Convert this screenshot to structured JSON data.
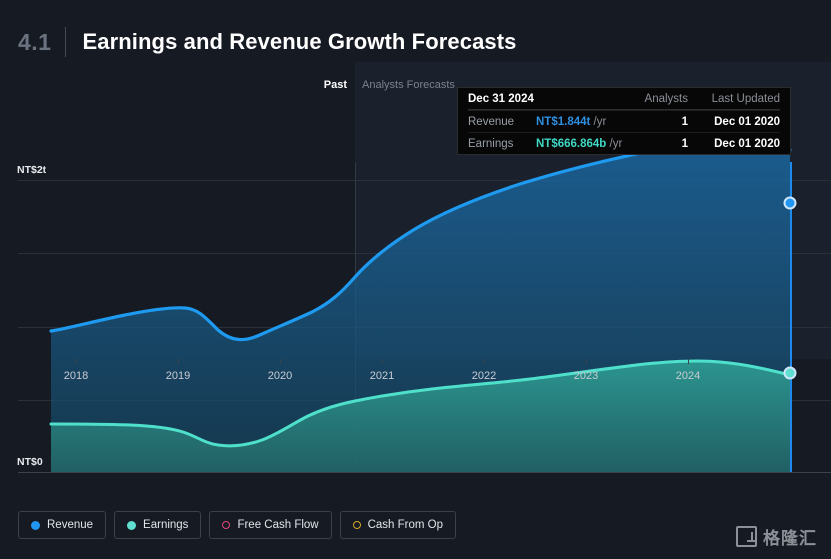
{
  "header": {
    "section_number": "4.1",
    "title": "Earnings and Revenue Growth Forecasts"
  },
  "tooltip": {
    "date": "Dec 31 2024",
    "col_analysts": "Analysts",
    "col_updated": "Last Updated",
    "rows": [
      {
        "name": "Revenue",
        "value": "NT$1.844t",
        "unit": "/yr",
        "analysts": "1",
        "updated": "Dec 01 2020",
        "color": "#2f8fe0"
      },
      {
        "name": "Earnings",
        "value": "NT$666.864b",
        "unit": "/yr",
        "analysts": "1",
        "updated": "Dec 01 2020",
        "color": "#3fd8c4"
      }
    ]
  },
  "chart_labels": {
    "past": "Past",
    "forecast": "Analysts Forecasts",
    "y_top": "NT$2t",
    "y_bottom": "NT$0"
  },
  "legend": [
    {
      "label": "Revenue",
      "color": "#2196f3",
      "filled": true
    },
    {
      "label": "Earnings",
      "color": "#5fded0",
      "filled": true
    },
    {
      "label": "Free Cash Flow",
      "color": "#e0457b",
      "filled": false
    },
    {
      "label": "Cash From Op",
      "color": "#d6a62a",
      "filled": false
    }
  ],
  "watermark": {
    "text": "格隆汇"
  },
  "chart_data": {
    "type": "area",
    "title": "Earnings and Revenue Growth Forecasts",
    "xlabel": "",
    "ylabel": "NT$",
    "ylim": [
      0,
      2.0
    ],
    "y_ticks": [
      0,
      0.5,
      1.0,
      1.5,
      2.0
    ],
    "y_tick_labels": [
      "NT$0",
      "",
      "",
      "",
      "NT$2t"
    ],
    "grid": true,
    "legend_position": "bottom-left",
    "categories": [
      "2018",
      "2019",
      "2020",
      "2021",
      "2022",
      "2023",
      "2024"
    ],
    "x_tick_values": [
      2018,
      2019,
      2020,
      2021,
      2022,
      2023,
      2024
    ],
    "forecast_start": 2020.72,
    "annotations": [
      {
        "text": "Past",
        "x": 2020.6
      },
      {
        "text": "Analysts Forecasts",
        "x": 2020.85
      }
    ],
    "highlight": {
      "x_label": "Dec 31 2024",
      "revenue": 1.844,
      "earnings": 0.666864
    },
    "series": [
      {
        "name": "Revenue",
        "color": "#2196f3",
        "unit": "NT$ trillions",
        "x": [
          2017.75,
          2018.0,
          2018.5,
          2019.0,
          2019.25,
          2019.5,
          2020.0,
          2020.5,
          2020.72,
          2021.0,
          2021.5,
          2022.0,
          2022.5,
          2023.0,
          2023.5,
          2024.0,
          2024.5,
          2025.0
        ],
        "values": [
          0.965,
          0.99,
          1.03,
          1.06,
          1.055,
          1.03,
          1.07,
          1.1,
          1.16,
          1.25,
          1.36,
          1.45,
          1.54,
          1.65,
          1.76,
          1.84,
          1.855,
          1.844
        ]
      },
      {
        "name": "Earnings",
        "color": "#5fded0",
        "unit": "NT$ trillions",
        "x": [
          2017.75,
          2018.0,
          2018.5,
          2019.0,
          2019.25,
          2019.5,
          2020.0,
          2020.5,
          2020.72,
          2021.0,
          2021.5,
          2022.0,
          2022.5,
          2023.0,
          2023.5,
          2024.0,
          2024.5,
          2025.0
        ],
        "values": [
          0.335,
          0.335,
          0.333,
          0.33,
          0.325,
          0.3,
          0.305,
          0.345,
          0.4,
          0.45,
          0.49,
          0.515,
          0.53,
          0.56,
          0.61,
          0.66,
          0.69,
          0.667
        ]
      },
      {
        "name": "Free Cash Flow",
        "color": "#e0457b",
        "values": [],
        "visible": false
      },
      {
        "name": "Cash From Op",
        "color": "#d6a62a",
        "values": [],
        "visible": false
      }
    ]
  }
}
